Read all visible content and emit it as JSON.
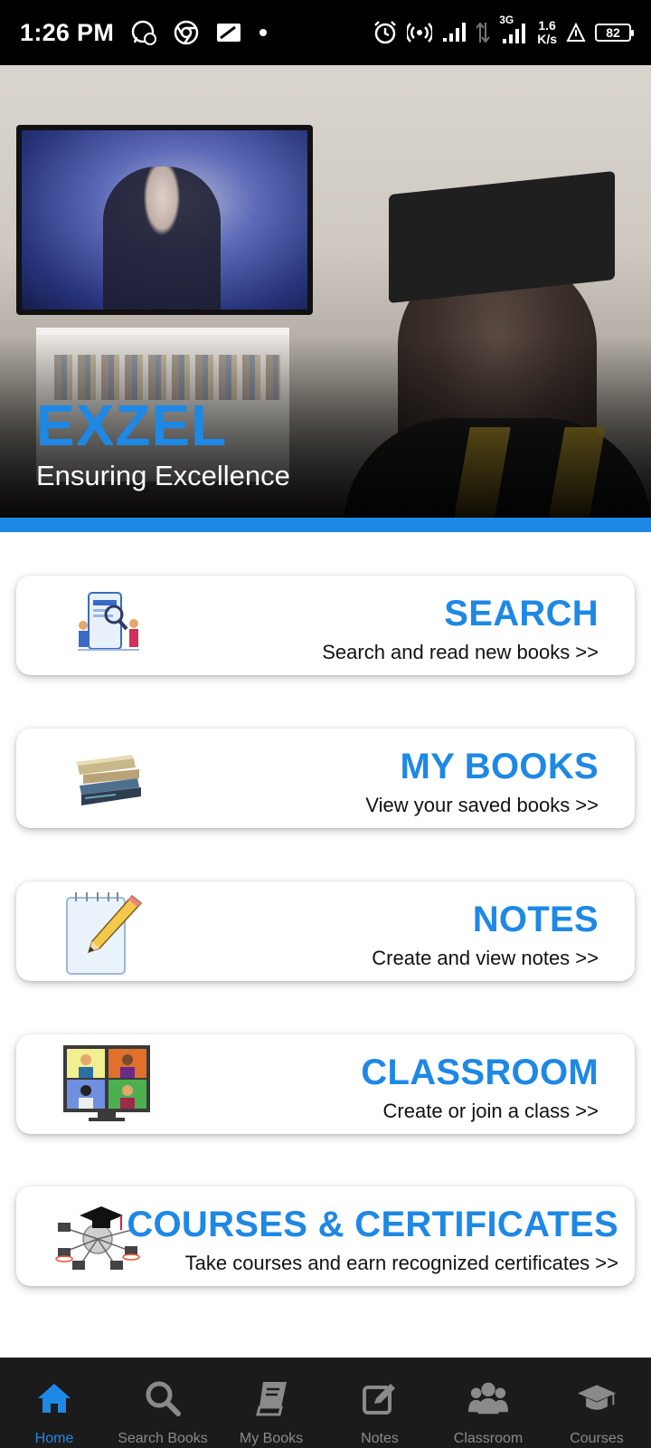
{
  "status_bar": {
    "time": "1:26 PM",
    "network_type": "3G",
    "net_speed_value": "1.6",
    "net_speed_unit": "K/s",
    "battery": "82"
  },
  "hero": {
    "brand": "EXZEL",
    "tagline": "Ensuring Excellence"
  },
  "cards": [
    {
      "title": "SEARCH",
      "subtitle": "Search and read new books  >>",
      "icon": "search-books-illustration-icon"
    },
    {
      "title": "MY BOOKS",
      "subtitle": "View your saved books  >>",
      "icon": "book-stack-icon"
    },
    {
      "title": "NOTES",
      "subtitle": "Create and view notes  >>",
      "icon": "notepad-pencil-icon"
    },
    {
      "title": "CLASSROOM",
      "subtitle": "Create or join a class >>",
      "icon": "video-classroom-icon"
    },
    {
      "title": "COURSES & CERTIFICATES",
      "subtitle": "Take courses and earn recognized certificates >>",
      "icon": "graduation-network-icon"
    }
  ],
  "bottom_nav": {
    "items": [
      {
        "label": "Home",
        "icon": "home-icon",
        "active": true
      },
      {
        "label": "Search Books",
        "icon": "search-icon",
        "active": false
      },
      {
        "label": "My Books",
        "icon": "book-icon",
        "active": false
      },
      {
        "label": "Notes",
        "icon": "edit-icon",
        "active": false
      },
      {
        "label": "Classroom",
        "icon": "users-icon",
        "active": false
      },
      {
        "label": "Courses",
        "icon": "graduation-cap-icon",
        "active": false
      }
    ]
  },
  "colors": {
    "accent": "#1e88e5",
    "nav_background": "#1b1b1b",
    "nav_inactive": "#8a8a8a"
  }
}
